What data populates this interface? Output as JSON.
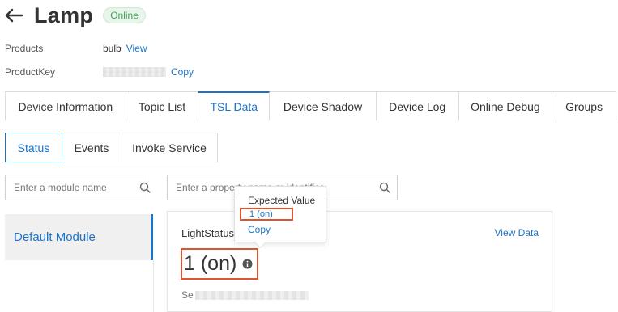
{
  "header": {
    "title": "Lamp",
    "status": "Online",
    "back_icon": "arrow-left-icon"
  },
  "meta": {
    "product_label": "Products",
    "product_value": "bulb",
    "product_link": "View",
    "productkey_label": "ProductKey",
    "productkey_link": "Copy"
  },
  "tabs": [
    {
      "label": "Device Information"
    },
    {
      "label": "Topic List"
    },
    {
      "label": "TSL Data"
    },
    {
      "label": "Device Shadow"
    },
    {
      "label": "Device Log"
    },
    {
      "label": "Online Debug"
    },
    {
      "label": "Groups"
    }
  ],
  "subtabs": [
    {
      "label": "Status"
    },
    {
      "label": "Events"
    },
    {
      "label": "Invoke Service"
    }
  ],
  "module_search": {
    "placeholder": "Enter a module name"
  },
  "property_search": {
    "placeholder": "Enter a property name or identifier"
  },
  "module": {
    "label": "Default Module"
  },
  "card": {
    "property_name": "LightStatus",
    "view_data": "View Data",
    "value": "1 (on)",
    "footer_prefix": "Se"
  },
  "popover": {
    "title": "Expected Value",
    "value": "1 (on)",
    "copy": "Copy"
  },
  "colors": {
    "accent": "#1a73c9",
    "highlight": "#e0542d",
    "online": "#43a057"
  }
}
